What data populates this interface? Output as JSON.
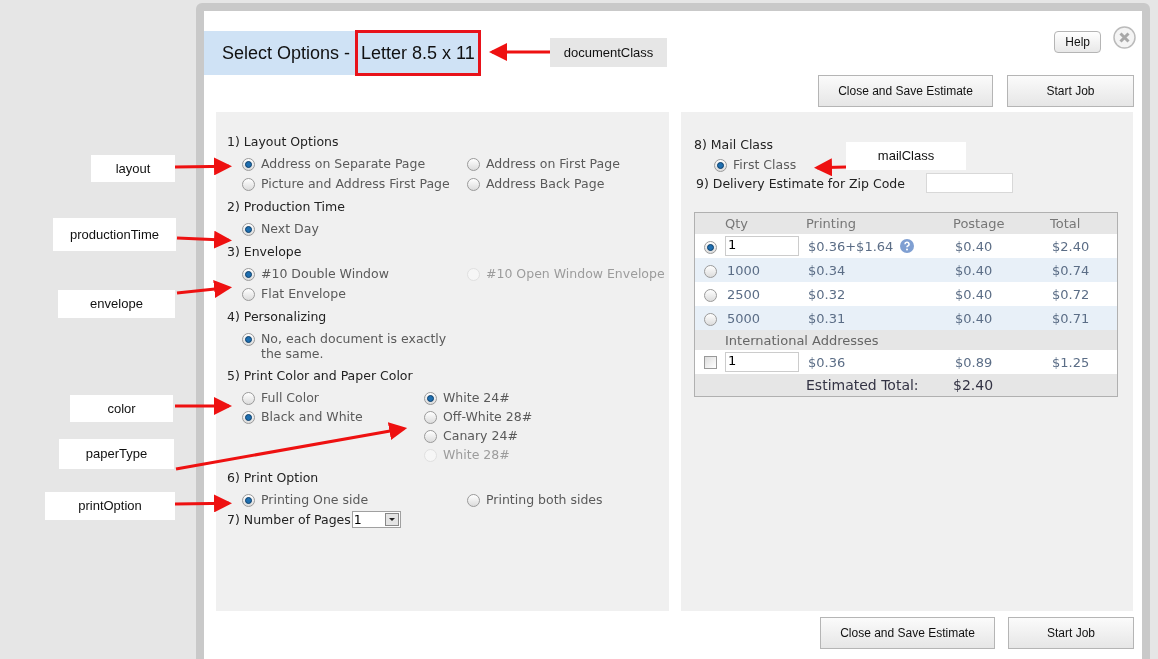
{
  "dialog": {
    "title": "Select Options - ",
    "document_class": "Letter 8.5 x 11",
    "help_button": "Help",
    "top_buttons": [
      "Close and Save Estimate",
      "Start Job"
    ],
    "bottom_buttons": [
      "Close and Save Estimate",
      "Start Job"
    ]
  },
  "sections": [
    {
      "kind": "grid",
      "heading": "1) Layout Options",
      "options": [
        {
          "label": "Address on Separate Page",
          "selected": true,
          "disabled": false
        },
        {
          "label": "Address on First Page",
          "selected": false,
          "disabled": false
        },
        {
          "label": "Picture and Address First Page",
          "selected": false,
          "disabled": false
        },
        {
          "label": "Address Back Page",
          "selected": false,
          "disabled": false
        }
      ]
    },
    {
      "kind": "grid",
      "heading": "2) Production Time",
      "options": [
        {
          "label": "Next Day",
          "selected": true,
          "disabled": false
        }
      ]
    },
    {
      "kind": "grid",
      "heading": "3) Envelope",
      "options": [
        {
          "label": "#10 Double Window",
          "selected": true,
          "disabled": false
        },
        {
          "label": "#10 Open Window Envelope",
          "selected": false,
          "disabled": true
        },
        {
          "label": "Flat Envelope",
          "selected": false,
          "disabled": false
        }
      ]
    },
    {
      "kind": "single",
      "heading": "4) Personalizing",
      "options": [
        {
          "label": "No, each document is exactly the same.",
          "selected": true,
          "disabled": false
        }
      ]
    },
    {
      "kind": "paper",
      "heading": "5) Print Color and Paper Color",
      "options": [
        {
          "label": "Full Color",
          "selected": false,
          "disabled": false
        },
        {
          "label": "Black and White",
          "selected": true,
          "disabled": false
        }
      ],
      "paper_options": [
        {
          "label": "White 24#",
          "selected": true,
          "disabled": false
        },
        {
          "label": "Off-White 28#",
          "selected": false,
          "disabled": false
        },
        {
          "label": "Canary 24#",
          "selected": false,
          "disabled": false
        },
        {
          "label": "White 28#",
          "selected": false,
          "disabled": true
        }
      ]
    },
    {
      "kind": "grid",
      "heading": "6) Print Option",
      "options": [
        {
          "label": "Printing One side",
          "selected": true,
          "disabled": false
        },
        {
          "label": "Printing both sides",
          "selected": false,
          "disabled": false
        }
      ]
    },
    {
      "kind": "select",
      "heading": "7) Number of Pages",
      "value": "1"
    }
  ],
  "mail": {
    "heading": "8) Mail Class",
    "options": [
      {
        "label": "First Class",
        "selected": true
      }
    ],
    "zip_label": "9) Delivery Estimate for Zip Code"
  },
  "table": {
    "columns": [
      "Qty",
      "Printing",
      "Postage",
      "Total"
    ],
    "rows": [
      {
        "kind": "input",
        "selected": true,
        "qty": "1",
        "printing": "$0.36+$1.64",
        "help": true,
        "postage": "$0.40",
        "total": "$2.40"
      },
      {
        "kind": "fixed",
        "selected": false,
        "qty": "1000",
        "printing": "$0.34",
        "help": false,
        "postage": "$0.40",
        "total": "$0.74"
      },
      {
        "kind": "fixed",
        "selected": false,
        "qty": "2500",
        "printing": "$0.32",
        "help": false,
        "postage": "$0.40",
        "total": "$0.72"
      },
      {
        "kind": "fixed",
        "selected": false,
        "qty": "5000",
        "printing": "$0.31",
        "help": false,
        "postage": "$0.40",
        "total": "$0.71"
      }
    ],
    "international": {
      "heading": "International Addresses",
      "checked": false,
      "qty": "1",
      "printing": "$0.36",
      "postage": "$0.89",
      "total": "$1.25"
    },
    "estimated_total": {
      "label": "Estimated Total:",
      "value": "$2.40"
    }
  },
  "annotations": [
    "documentClass",
    "layout",
    "productionTime",
    "envelope",
    "color",
    "paperType",
    "printOption",
    "mailClass"
  ]
}
